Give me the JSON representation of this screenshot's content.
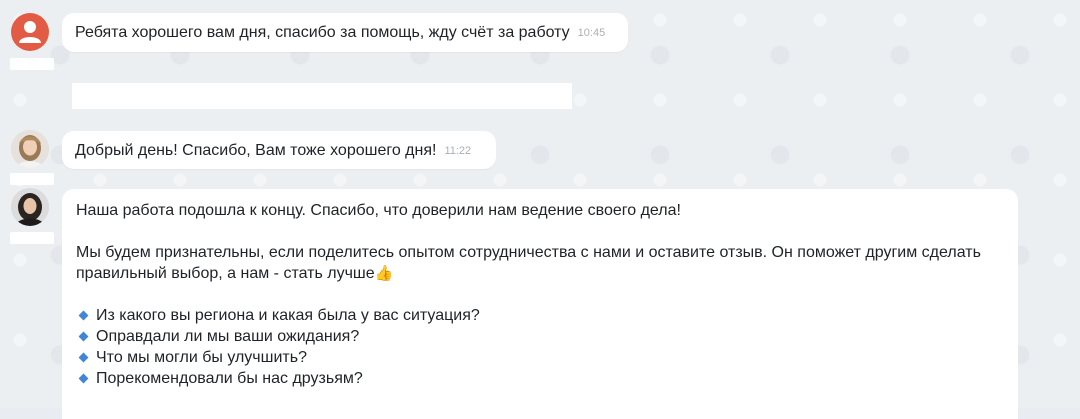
{
  "messages": [
    {
      "text": "Ребята хорошего вам дня, спасибо за помощь, жду счёт за работу",
      "time": "10:45"
    },
    {
      "text": "Добрый день! Спасибо, Вам тоже хорошего дня!",
      "time": "11:22"
    },
    {
      "p1": "Наша работа подошла к концу. Спасибо, что доверили нам ведение своего дела!",
      "p2_line1": "Мы будем признательны, если поделитесь опытом сотрудничества с нами и оставите отзыв. Он поможет другим сделать",
      "p2_line2": "правильный выбор, а нам - стать лучше",
      "thumb_emoji": "👍",
      "questions": [
        "Из какого вы региона и какая была у вас ситуация?",
        "Оправдали ли мы ваши ожидания?",
        "Что мы могли бы улучшить?",
        "Порекомендовали бы нас друзьям?"
      ]
    }
  ],
  "colors": {
    "generic_avatar": "#e25b45",
    "bullet_accent": "#3f86d9"
  }
}
